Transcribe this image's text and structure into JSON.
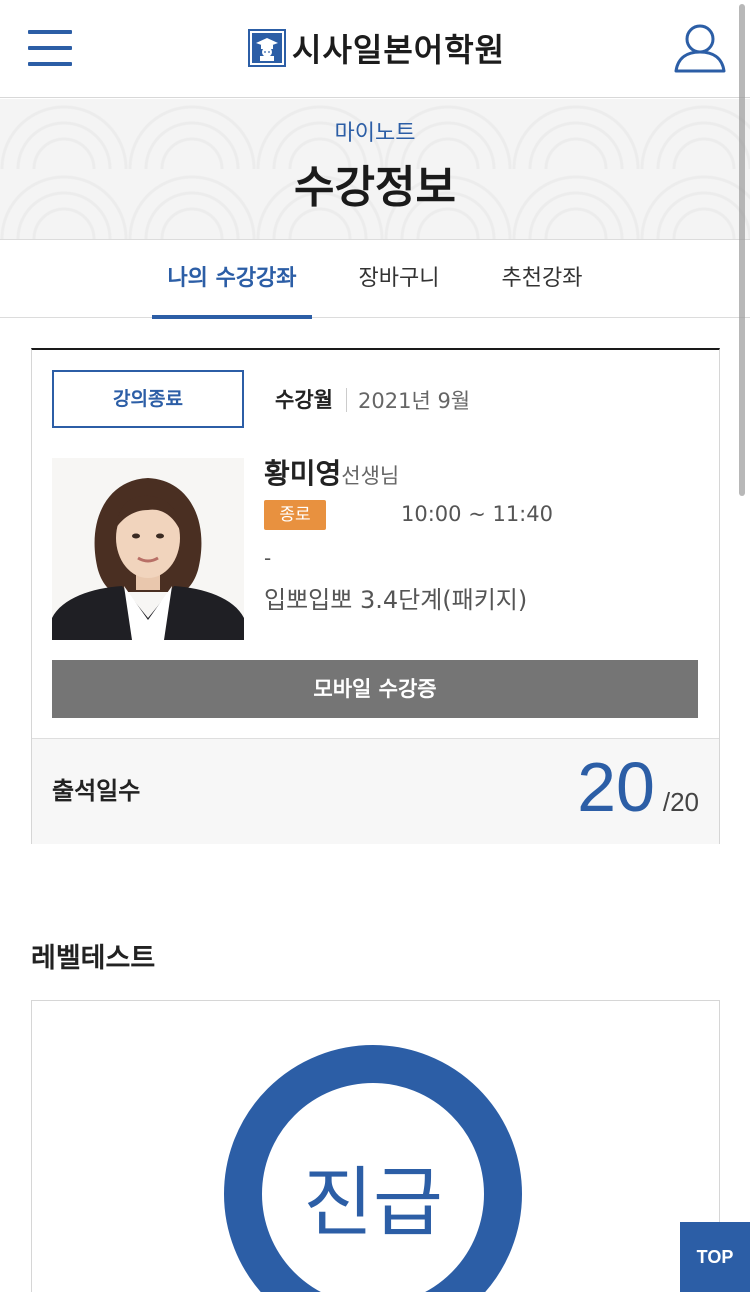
{
  "header": {
    "logo_text": "시사일본어학원",
    "menu_icon": "hamburger-menu-icon",
    "user_icon": "user-icon",
    "accent_color": "#2c5ea6"
  },
  "banner": {
    "subtitle": "마이노트",
    "title": "수강정보"
  },
  "tabs": [
    {
      "label": "나의 수강강좌",
      "active": true
    },
    {
      "label": "장바구니",
      "active": false
    },
    {
      "label": "추천강좌",
      "active": false
    }
  ],
  "course": {
    "status": "강의종료",
    "month_label": "수강월",
    "month_value": "2021년 9월",
    "teacher_name": "황미영",
    "teacher_suffix": "선생님",
    "state_badge": "종로",
    "time": "10:00 ~ 11:40",
    "dash": "-",
    "course_name": "입뽀입뽀 3.4단계(패키지)",
    "mobile_button": "모바일 수강증",
    "attendance_label": "출석일수",
    "attendance_value": "20",
    "attendance_total": "/20",
    "badge_color": "#e8913f"
  },
  "level_test": {
    "title": "레벨테스트",
    "result": "진급"
  },
  "top_button": "TOP"
}
